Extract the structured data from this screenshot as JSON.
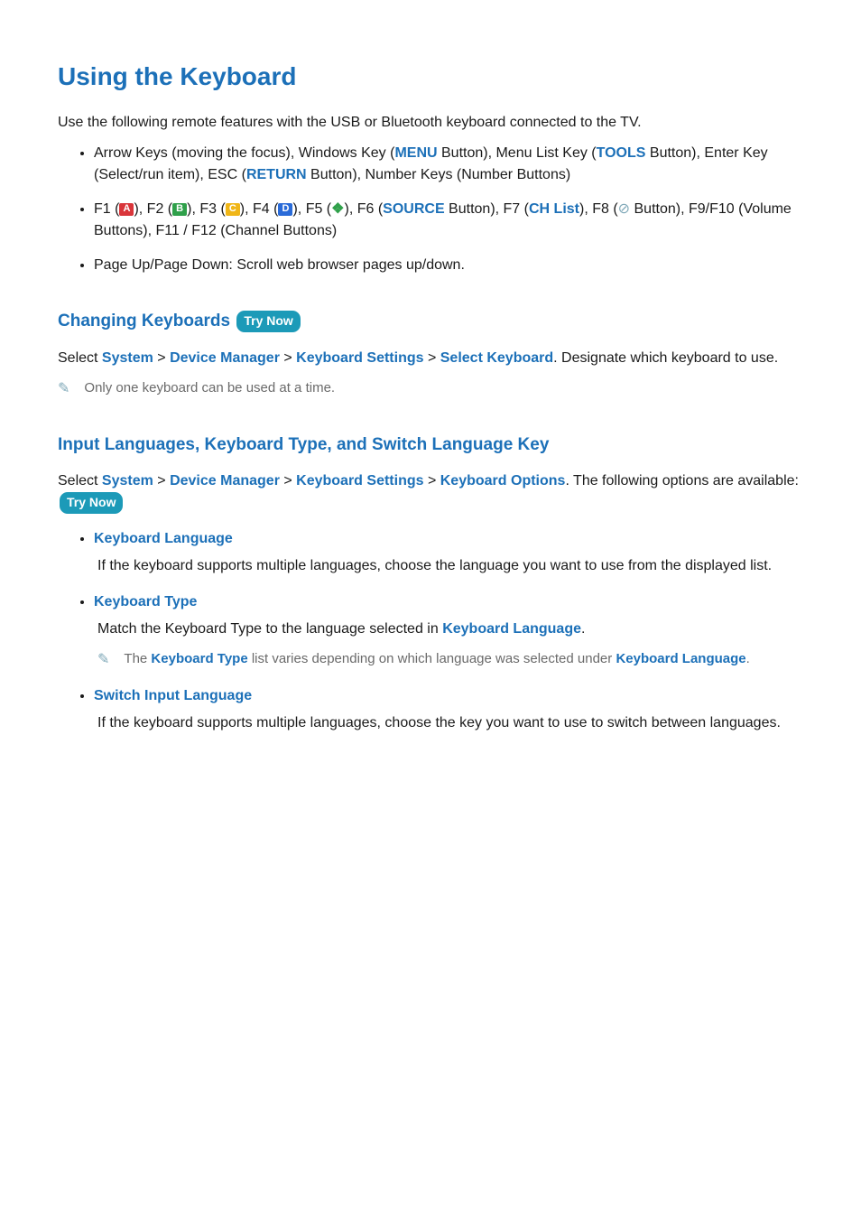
{
  "title": "Using the Keyboard",
  "intro": "Use the following remote features with the USB or Bluetooth keyboard connected to the TV.",
  "bullets": {
    "b1": {
      "t1": "Arrow Keys (moving the focus), Windows Key (",
      "menu": "MENU",
      "t2": " Button), Menu List Key (",
      "tools": "TOOLS",
      "t3": " Button), Enter Key (Select/run item), ESC (",
      "return": "RETURN",
      "t4": " Button), Number Keys (Number Buttons)"
    },
    "b2": {
      "f1": "F1 (",
      "keyA": "A",
      "f2": "), F2 (",
      "keyB": "B",
      "f3": "), F3 (",
      "keyC": "C",
      "f4": "), F4 (",
      "keyD": "D",
      "f5a": "), F5 (",
      "voice": "❖",
      "f5b": "), F6 (",
      "source": "SOURCE",
      "f6": " Button), F7 (",
      "chlist": "CH List",
      "f7": "), F8 (",
      "mute": "⊘",
      "f8": " Button), F9/F10 (Volume Buttons), F11 / F12 (Channel Buttons)"
    },
    "b3": "Page Up/Page Down: Scroll web browser pages up/down."
  },
  "section1": {
    "heading": "Changing Keyboards",
    "trynow": "Try Now",
    "sel": "Select ",
    "path1": "System",
    "gt1": " > ",
    "path2": "Device Manager",
    "gt2": " > ",
    "path3": "Keyboard Settings",
    "gt3": " > ",
    "path4": "Select Keyboard",
    "after": ". Designate which keyboard to use.",
    "note": "Only one keyboard can be used at a time."
  },
  "section2": {
    "heading": "Input Languages, Keyboard Type, and Switch Language Key",
    "sel": "Select ",
    "path1": "System",
    "gt1": " > ",
    "path2": "Device Manager",
    "gt2": " > ",
    "path3": "Keyboard Settings",
    "gt3": " > ",
    "path4": "Keyboard Options",
    "after": ". The following options are available: ",
    "trynow": "Try Now",
    "opts": [
      {
        "name": "Keyboard Language",
        "body": "If the keyboard supports multiple languages, choose the language you want to use from the displayed list."
      },
      {
        "name": "Keyboard Type",
        "body_a": "Match the Keyboard Type to the language selected in ",
        "body_hl": "Keyboard Language",
        "body_b": ".",
        "note_a": "The ",
        "note_hl1": "Keyboard Type",
        "note_b": " list varies depending on which language was selected under ",
        "note_hl2": "Keyboard Language",
        "note_c": "."
      },
      {
        "name": "Switch Input Language",
        "body": "If the keyboard supports multiple languages, choose the key you want to use to switch between languages."
      }
    ]
  },
  "pencil_glyph": "✎"
}
